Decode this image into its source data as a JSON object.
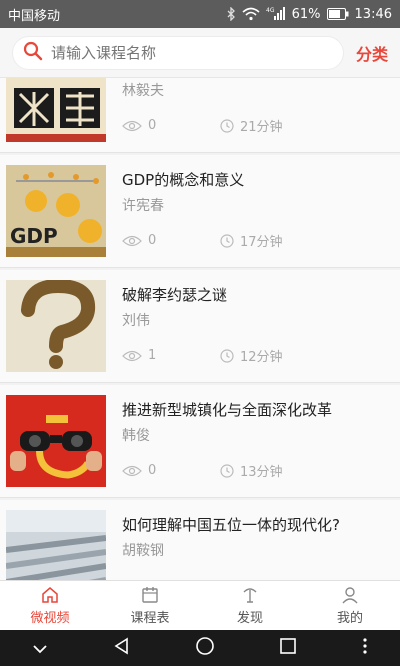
{
  "status": {
    "carrier": "中国移动",
    "battery": "61%",
    "time": "13:46"
  },
  "search": {
    "placeholder": "请输入课程名称",
    "category_label": "分类"
  },
  "colors": {
    "accent": "#e8473a"
  },
  "items": [
    {
      "title": "",
      "author": "林毅夫",
      "views": "0",
      "duration": "21分钟"
    },
    {
      "title": "GDP的概念和意义",
      "author": "许宪春",
      "views": "0",
      "duration": "17分钟"
    },
    {
      "title": "破解李约瑟之谜",
      "author": "刘伟",
      "views": "1",
      "duration": "12分钟"
    },
    {
      "title": "推进新型城镇化与全面深化改革",
      "author": "韩俊",
      "views": "0",
      "duration": "13分钟"
    },
    {
      "title": "如何理解中国五位一体的现代化?",
      "author": "胡鞍钢",
      "views": "",
      "duration": ""
    }
  ],
  "tabs": [
    {
      "label": "微视频",
      "icon": "home-icon"
    },
    {
      "label": "课程表",
      "icon": "schedule-icon"
    },
    {
      "label": "发现",
      "icon": "discover-icon"
    },
    {
      "label": "我的",
      "icon": "profile-icon"
    }
  ]
}
